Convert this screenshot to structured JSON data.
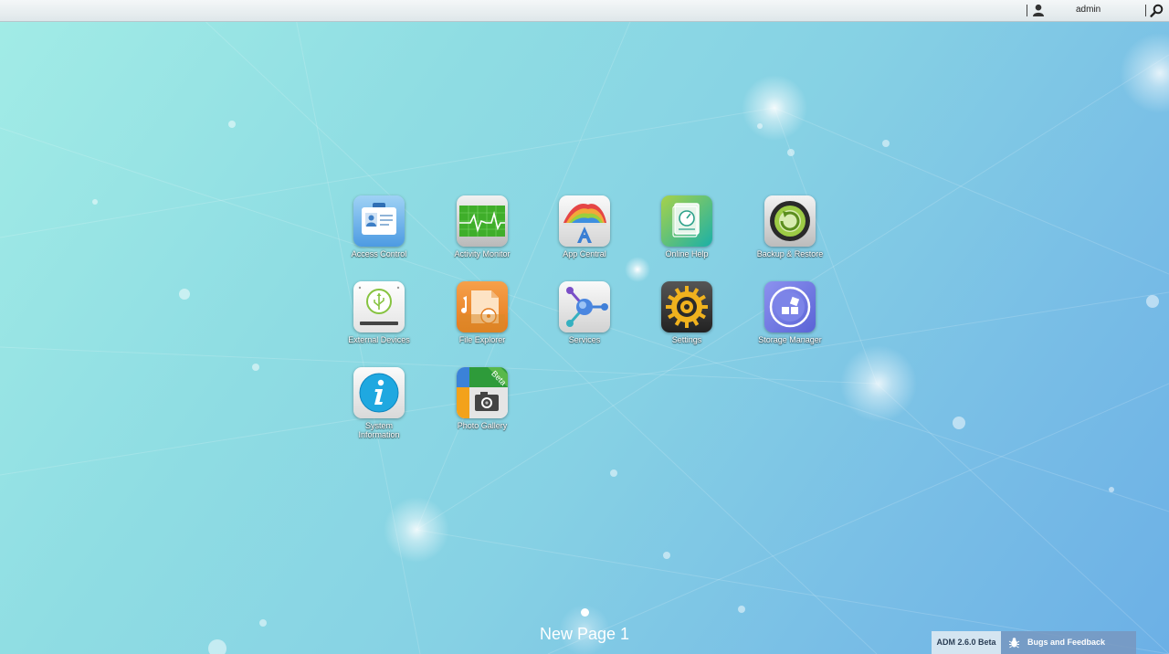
{
  "topbar": {
    "username": "admin"
  },
  "apps": [
    {
      "id": "access-control",
      "label": "Access Control"
    },
    {
      "id": "activity-monitor",
      "label": "Activity Monitor"
    },
    {
      "id": "app-central",
      "label": "App Central"
    },
    {
      "id": "online-help",
      "label": "Online Help"
    },
    {
      "id": "backup-restore",
      "label": "Backup & Restore"
    },
    {
      "id": "external-devices",
      "label": "External Devices"
    },
    {
      "id": "file-explorer",
      "label": "File Explorer"
    },
    {
      "id": "services",
      "label": "Services"
    },
    {
      "id": "settings",
      "label": "Settings"
    },
    {
      "id": "storage-manager",
      "label": "Storage Manager"
    },
    {
      "id": "system-information",
      "label": "System Information"
    },
    {
      "id": "photo-gallery",
      "label": "Photo Gallery",
      "badge": "Beta"
    }
  ],
  "pager": {
    "current_page": "New Page 1"
  },
  "footer": {
    "version": "ADM 2.6.0 Beta",
    "feedback": "Bugs and Feedback"
  }
}
